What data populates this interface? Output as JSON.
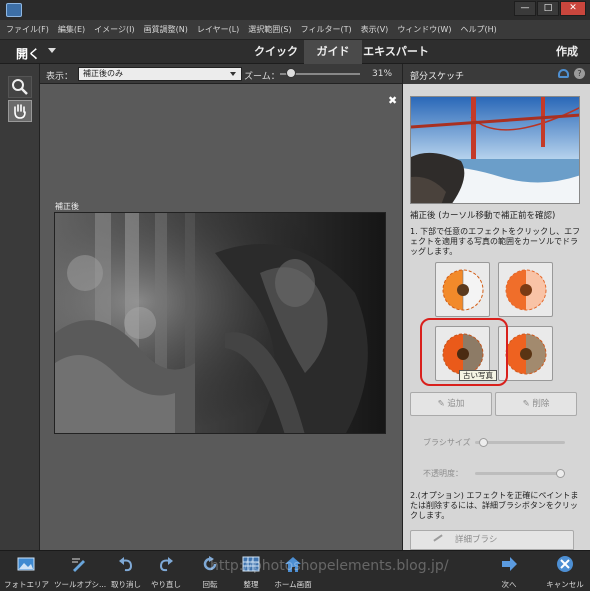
{
  "menu": [
    "ファイル(F)",
    "編集(E)",
    "イメージ(I)",
    "画質調整(N)",
    "レイヤー(L)",
    "選択範囲(S)",
    "フィルター(T)",
    "表示(V)",
    "ウィンドウ(W)",
    "ヘルプ(H)"
  ],
  "window_controls": {
    "minimize": "—",
    "restore": "□",
    "close": "✕"
  },
  "modebar": {
    "open": "開く",
    "tabs": [
      "クイック",
      "ガイド",
      "エキスパート"
    ],
    "active_tab": "ガイド",
    "create": "作成"
  },
  "options": {
    "view_label": "表示：",
    "view_value": "補正後のみ",
    "zoom_label": "ズーム：",
    "zoom_value": "31%",
    "zoom_level": 0.08
  },
  "canvas": {
    "close": "✖",
    "after_label": "補正後"
  },
  "panel": {
    "title": "部分スケッチ",
    "help": "?",
    "preview_caption": "補正後 (カーソル移動で補正前を確認)",
    "step1": "1. 下部で任意のエフェクトをクリックし、エフェクトを適用する写真の範囲をカーソルでドラッグします。",
    "tooltip": "古い写真",
    "add_button": "追加",
    "remove_button": "削除",
    "brush_size_label": "ブラシサイズ",
    "opacity_label": "不透明度：",
    "brush_size_level": 0.05,
    "opacity_level": 1.0,
    "step2": "2.(オプション) エフェクトを正確にペイントまたは削除するには、詳細ブラシボタンをクリックします。",
    "detail_brush": "詳細ブラシ"
  },
  "bottombar": {
    "items": [
      "フォトエリア",
      "ツールオプシ...",
      "取り消し",
      "やり直し",
      "回転",
      "整理",
      "ホーム画面"
    ],
    "next": "次へ",
    "cancel": "キャンセル"
  },
  "watermark": "http://photoshopelements.blog.jp/",
  "colors": {
    "accent_ring": "#d9201c",
    "panel_bg": "#d6d6d6",
    "chrome_dark": "#2b2b2b"
  }
}
